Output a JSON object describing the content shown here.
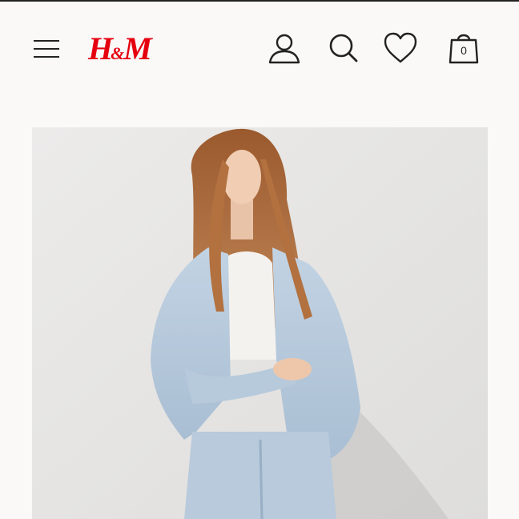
{
  "header": {
    "logo_text_left": "H",
    "logo_amp": "&",
    "logo_text_right": "M",
    "brand_color": "#e50010",
    "icons": [
      "menu-icon",
      "user-icon",
      "search-icon",
      "heart-icon",
      "shopping-bag-icon"
    ],
    "bag_count": "0"
  },
  "hero": {
    "image": "model-in-light-denim-jacket"
  }
}
